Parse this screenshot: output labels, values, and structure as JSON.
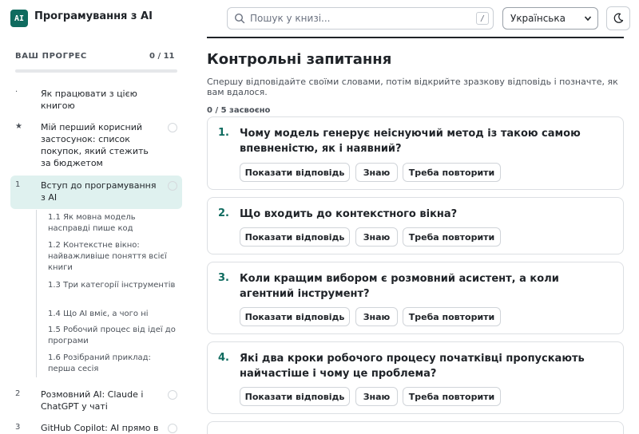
{
  "header": {
    "logo_text": "AI",
    "app_title": "Програмування з AI",
    "search_placeholder": "Пошук у книзі...",
    "search_shortcut": "/",
    "language": "Українська",
    "theme_icon": "moon-icon"
  },
  "sidebar": {
    "progress_label": "ВАШ ПРОГРЕС",
    "progress_count": "0 / 11",
    "progress_fraction": 0,
    "items": [
      {
        "num": "·",
        "label": "Як працювати з цією книгою",
        "has_circle": false
      },
      {
        "num": "★",
        "label": "Мій перший корисний застосунок: список покупок, який стежить за бюджетом",
        "has_circle": true
      },
      {
        "num": "1",
        "label": "Вступ до програмування з AI",
        "has_circle": true,
        "active": true
      },
      {
        "num": "2",
        "label": "Розмовний AI: Claude і ChatGPT у чаті",
        "has_circle": true
      },
      {
        "num": "3",
        "label": "GitHub Copilot: AI прямо в",
        "has_circle": true
      }
    ],
    "subitems": [
      "1.1  Як мовна модель насправді пише код",
      "1.2  Контекстне вікно: найважливіше поняття всієї книги",
      "1.3  Три категорії інструментів",
      "1.4  Що AI вміє, а чого ні",
      "1.5  Робочий процес від ідеї до програми",
      "1.6  Розібраний приклад: перша сесія"
    ]
  },
  "main": {
    "title": "Контрольні запитання",
    "description": "Спершу відповідайте своїми словами, потім відкрийте зразкову відповідь і позначте, як вам вдалося.",
    "mastered": "0 / 5 засвоєно",
    "buttons": {
      "show": "Показати відповідь",
      "know": "Знаю",
      "review": "Треба повторити"
    },
    "questions": [
      {
        "num": "1.",
        "text": "Чому модель генерує неіснуючий метод із такою самою впевненістю, як і наявний?"
      },
      {
        "num": "2.",
        "text": "Що входить до контекстного вікна?"
      },
      {
        "num": "3.",
        "text": "Коли кращим вибором є розмовний асистент, а коли агентний інструмент?"
      },
      {
        "num": "4.",
        "text": "Які два кроки робочого процесу початківці пропускають найчастіше і чому це проблема?"
      }
    ]
  },
  "colors": {
    "accent": "#0f6b5f",
    "active_bg": "#dff1ef"
  }
}
